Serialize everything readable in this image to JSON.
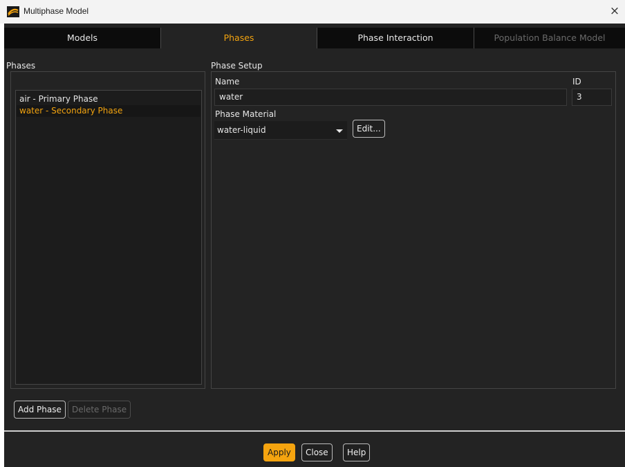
{
  "window": {
    "title": "Multiphase Model",
    "close_glyph": "×",
    "icon": "fluent-logo-icon"
  },
  "tabs": [
    {
      "label": "Models",
      "state": "normal"
    },
    {
      "label": "Phases",
      "state": "active"
    },
    {
      "label": "Phase Interaction",
      "state": "normal"
    },
    {
      "label": "Population Balance Model",
      "state": "disabled"
    }
  ],
  "phases_panel": {
    "label": "Phases",
    "items": [
      {
        "label": "air - Primary Phase",
        "selected": false
      },
      {
        "label": "water - Secondary Phase",
        "selected": true
      }
    ],
    "add_button": "Add Phase",
    "delete_button": "Delete Phase"
  },
  "phase_setup": {
    "label": "Phase Setup",
    "name_label": "Name",
    "name_value": "water",
    "id_label": "ID",
    "id_value": "3",
    "material_label": "Phase Material",
    "material_value": "water-liquid",
    "edit_button": "Edit..."
  },
  "footer": {
    "apply": "Apply",
    "close": "Close",
    "help": "Help"
  },
  "colors": {
    "accent": "#f5a40f",
    "background": "#232323",
    "tab_bar": "#0c0c0c"
  }
}
